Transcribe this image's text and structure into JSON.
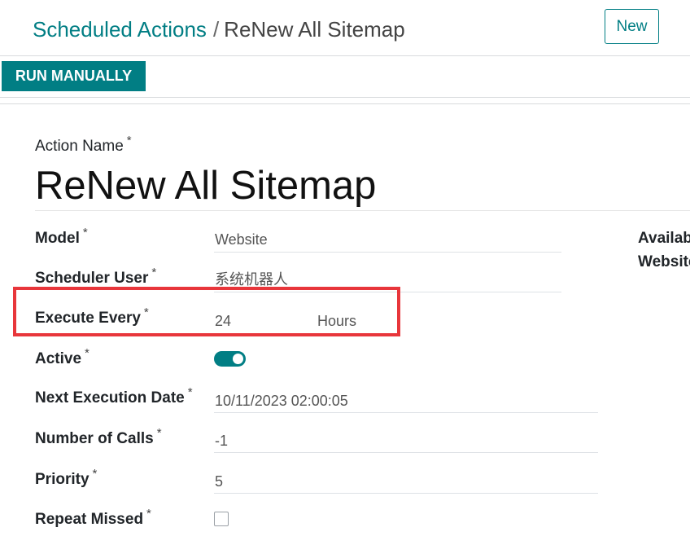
{
  "breadcrumb": {
    "parent": "Scheduled Actions",
    "separator": "/",
    "current": "ReNew All Sitemap"
  },
  "header": {
    "new_label": "New"
  },
  "toolbar": {
    "run_manually_label": "RUN MANUALLY"
  },
  "form": {
    "action_name_label": "Action Name",
    "action_name_value": "ReNew All Sitemap",
    "required_mark": "*",
    "fields": {
      "model": {
        "label": "Model",
        "value": "Website"
      },
      "scheduler_user": {
        "label": "Scheduler User",
        "value": "系统机器人"
      },
      "execute_every": {
        "label": "Execute Every",
        "value": "24",
        "unit": "Hours"
      },
      "active": {
        "label": "Active",
        "value": true
      },
      "next_execution_date": {
        "label": "Next Execution Date",
        "value": "10/11/2023 02:00:05"
      },
      "number_of_calls": {
        "label": "Number of Calls",
        "value": "-1"
      },
      "priority": {
        "label": "Priority",
        "value": "5"
      },
      "repeat_missed": {
        "label": "Repeat Missed",
        "value": false
      }
    }
  },
  "side_panel": {
    "line1": "Availab",
    "line2": "Website"
  },
  "colors": {
    "primary": "#017e84",
    "highlight": "#e8363b"
  }
}
